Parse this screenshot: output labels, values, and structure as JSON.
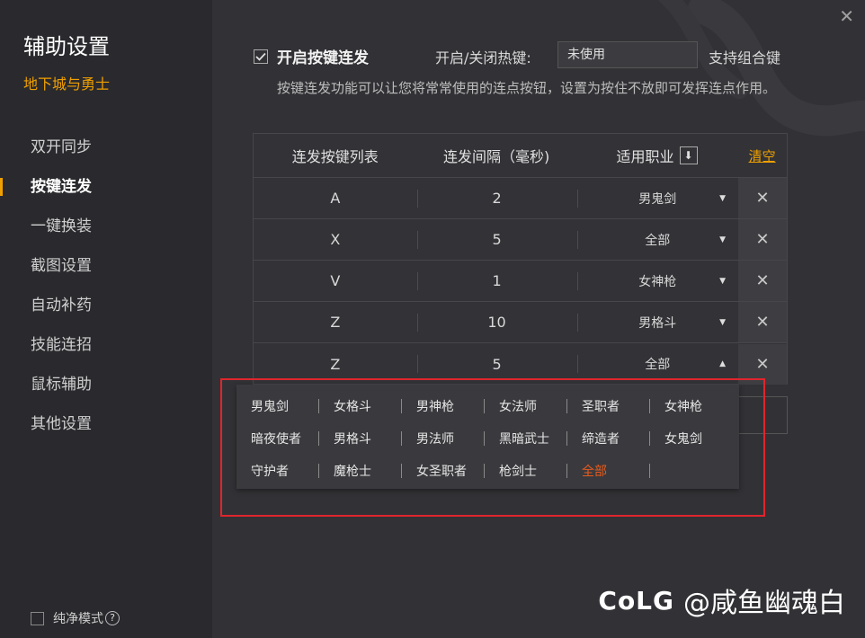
{
  "sidebar": {
    "title": "辅助设置",
    "game": "地下城与勇士",
    "items": [
      {
        "label": "双开同步",
        "active": false
      },
      {
        "label": "按键连发",
        "active": true
      },
      {
        "label": "一键换装",
        "active": false
      },
      {
        "label": "截图设置",
        "active": false
      },
      {
        "label": "自动补药",
        "active": false
      },
      {
        "label": "技能连招",
        "active": false
      },
      {
        "label": "鼠标辅助",
        "active": false
      },
      {
        "label": "其他设置",
        "active": false
      }
    ],
    "pure_mode": {
      "label": "纯净模式",
      "checked": false
    }
  },
  "main": {
    "close": "✕",
    "enable": {
      "label": "开启按键连发",
      "checked": true
    },
    "hotkey": {
      "label": "开启/关闭热键:",
      "value": "未使用",
      "combo_label": "支持组合键"
    },
    "description": "按键连发功能可以让您将常常使用的连点按钮，设置为按住不放即可发挥连点作用。",
    "table": {
      "headers": {
        "keys": "连发按键列表",
        "interval": "连发间隔（毫秒)",
        "class": "适用职业",
        "clear": "清空"
      },
      "rows": [
        {
          "key": "A",
          "interval": "2",
          "class": "男鬼剑",
          "arrow": "▼"
        },
        {
          "key": "X",
          "interval": "5",
          "class": "全部",
          "arrow": "▼"
        },
        {
          "key": "V",
          "interval": "1",
          "class": "女神枪",
          "arrow": "▼"
        },
        {
          "key": "Z",
          "interval": "10",
          "class": "男格斗",
          "arrow": "▼"
        },
        {
          "key": "Z",
          "interval": "5",
          "class": "全部",
          "arrow": "▲"
        }
      ],
      "delete_icon": "✕"
    },
    "dropdown": {
      "rows": [
        [
          "男鬼剑",
          "女格斗",
          "男神枪",
          "女法师",
          "圣职者",
          "女神枪"
        ],
        [
          "暗夜使者",
          "男格斗",
          "男法师",
          "黑暗武士",
          "缔造者",
          "女鬼剑"
        ],
        [
          "守护者",
          "魔枪士",
          "女圣职者",
          "枪剑士",
          "全部",
          ""
        ]
      ],
      "selected": "全部",
      "accent_color": "#e85a1a"
    }
  },
  "watermark": {
    "logo": "CoLG",
    "text": "@咸鱼幽魂白"
  },
  "colors": {
    "accent": "#f0a000",
    "highlight": "#e0252d",
    "selected": "#e85a1a"
  }
}
